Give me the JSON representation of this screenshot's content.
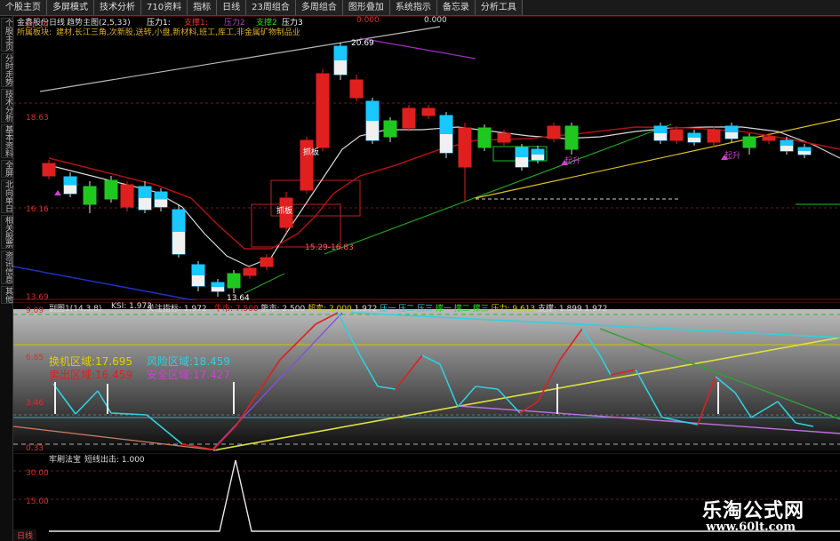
{
  "toolbar": {
    "items": [
      "个股主页",
      "多屏模式",
      "技术分析",
      "710资料",
      "指标",
      "日线",
      "23周组合",
      "多周组合",
      "图形叠加",
      "系统指示",
      "备忘录",
      "分析工具"
    ]
  },
  "sidebar": {
    "items": [
      "个股主页",
      "分时走势",
      "技术分析",
      "基本资料",
      "全屏",
      "北向单日",
      "相关股票",
      "资讯信息",
      "其他"
    ]
  },
  "main_header": {
    "title": "金鑫股份日线",
    "indicator": "趋势主图(2,5,33)",
    "p1": "压力1:",
    "s1": "支撑1:",
    "p2": "压力2",
    "s2": "支撑2",
    "p3": "压力3",
    "info1": "0.000",
    "info2": "0.000",
    "sector_label": "所属板块:",
    "sectors": "建材,长江三角,次新股,送转,小盘,新材料,班工,库工,非金属矿物制品业"
  },
  "main_yaxis": [
    "21.10",
    "18.63",
    "16.16",
    "13.69"
  ],
  "annotations": {
    "peak": "20.69",
    "low": "13.64",
    "band": "15.29-16.83",
    "zhaban": "抓板",
    "qijia": "起升"
  },
  "sub1_header": {
    "name": "副图1(14,3,8)",
    "k": "KSI: 1.972",
    "guanjian": "关注指标: 1.972",
    "items": [
      "牛市: 7.500",
      "熊市: 2.500",
      "超卖: 2.000",
      "1.972",
      "压一",
      "压二",
      "压三",
      "撑一",
      "撑二",
      "撑三",
      "压力: 9.613",
      "支撑: 1.899",
      "1.972"
    ]
  },
  "sub1_yaxis": [
    "9.09",
    "6.65",
    "3.46",
    "0.33"
  ],
  "zones": {
    "huanji": "换机区域:17.695",
    "fengxian": "风险区域:18.459",
    "maichu": "卖出区域:16.459",
    "anquan": "安全区域:17.427"
  },
  "sub2_header": {
    "name": "牢刷法宝",
    "sig": "短线出击: 1.000"
  },
  "sub2_yaxis": [
    "30.00",
    "15.00"
  ],
  "bottom": {
    "tab": "日线"
  },
  "watermark": {
    "brand": "乐淘公式网",
    "url": "www.60lt.com"
  },
  "colors": {
    "up": "#e0201e",
    "down": "#18c8ff",
    "ma_white": "#d8d8d8",
    "ma_red": "#b01010",
    "green": "#1fc81f",
    "yellow": "#e0d000",
    "cyan": "#30d0e0"
  }
}
